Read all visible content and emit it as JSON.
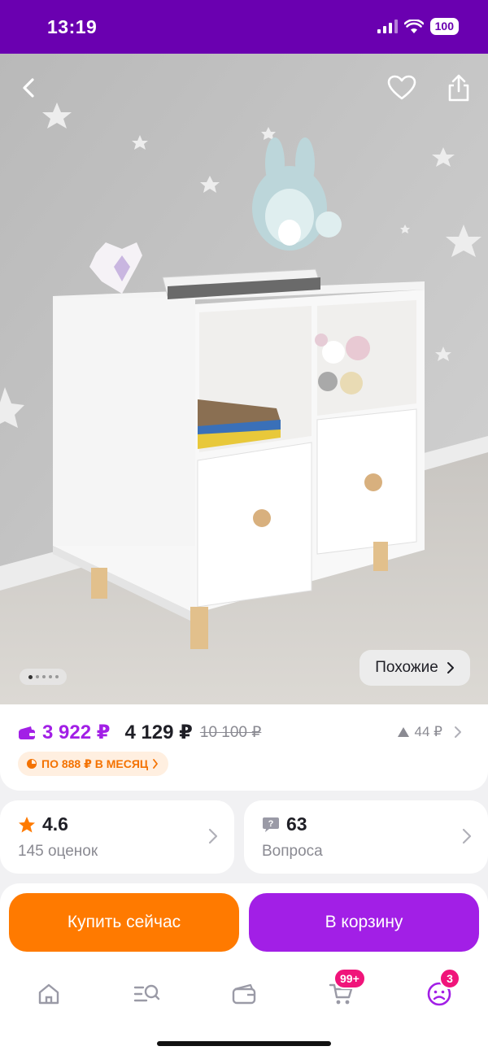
{
  "status_bar": {
    "time": "13:19",
    "battery": "100"
  },
  "gallery": {
    "total_images": 5,
    "current_index": 1,
    "similar_label": "Похожие"
  },
  "price": {
    "wallet_price": "3 922 ₽",
    "price": "4 129 ₽",
    "old_price": "10 100 ₽",
    "delta": "44 ₽",
    "installment": "ПО 888 ₽ В МЕСЯЦ"
  },
  "rating": {
    "value": "4.6",
    "count_label": "145 оценок"
  },
  "questions": {
    "count": "63",
    "label": "Вопроса"
  },
  "actions": {
    "buy_now": "Купить сейчас",
    "add_to_cart": "В корзину"
  },
  "tabbar": {
    "items": [
      {
        "icon": "home-icon"
      },
      {
        "icon": "catalog-search-icon"
      },
      {
        "icon": "wallet-icon"
      },
      {
        "icon": "cart-icon",
        "badge": "99+"
      },
      {
        "icon": "profile-icon",
        "badge": "3"
      }
    ]
  },
  "colors": {
    "brand_purple": "#6a00b0",
    "accent_purple": "#a21fe6",
    "orange": "#ff7a00",
    "badge_pink": "#f0147a"
  }
}
